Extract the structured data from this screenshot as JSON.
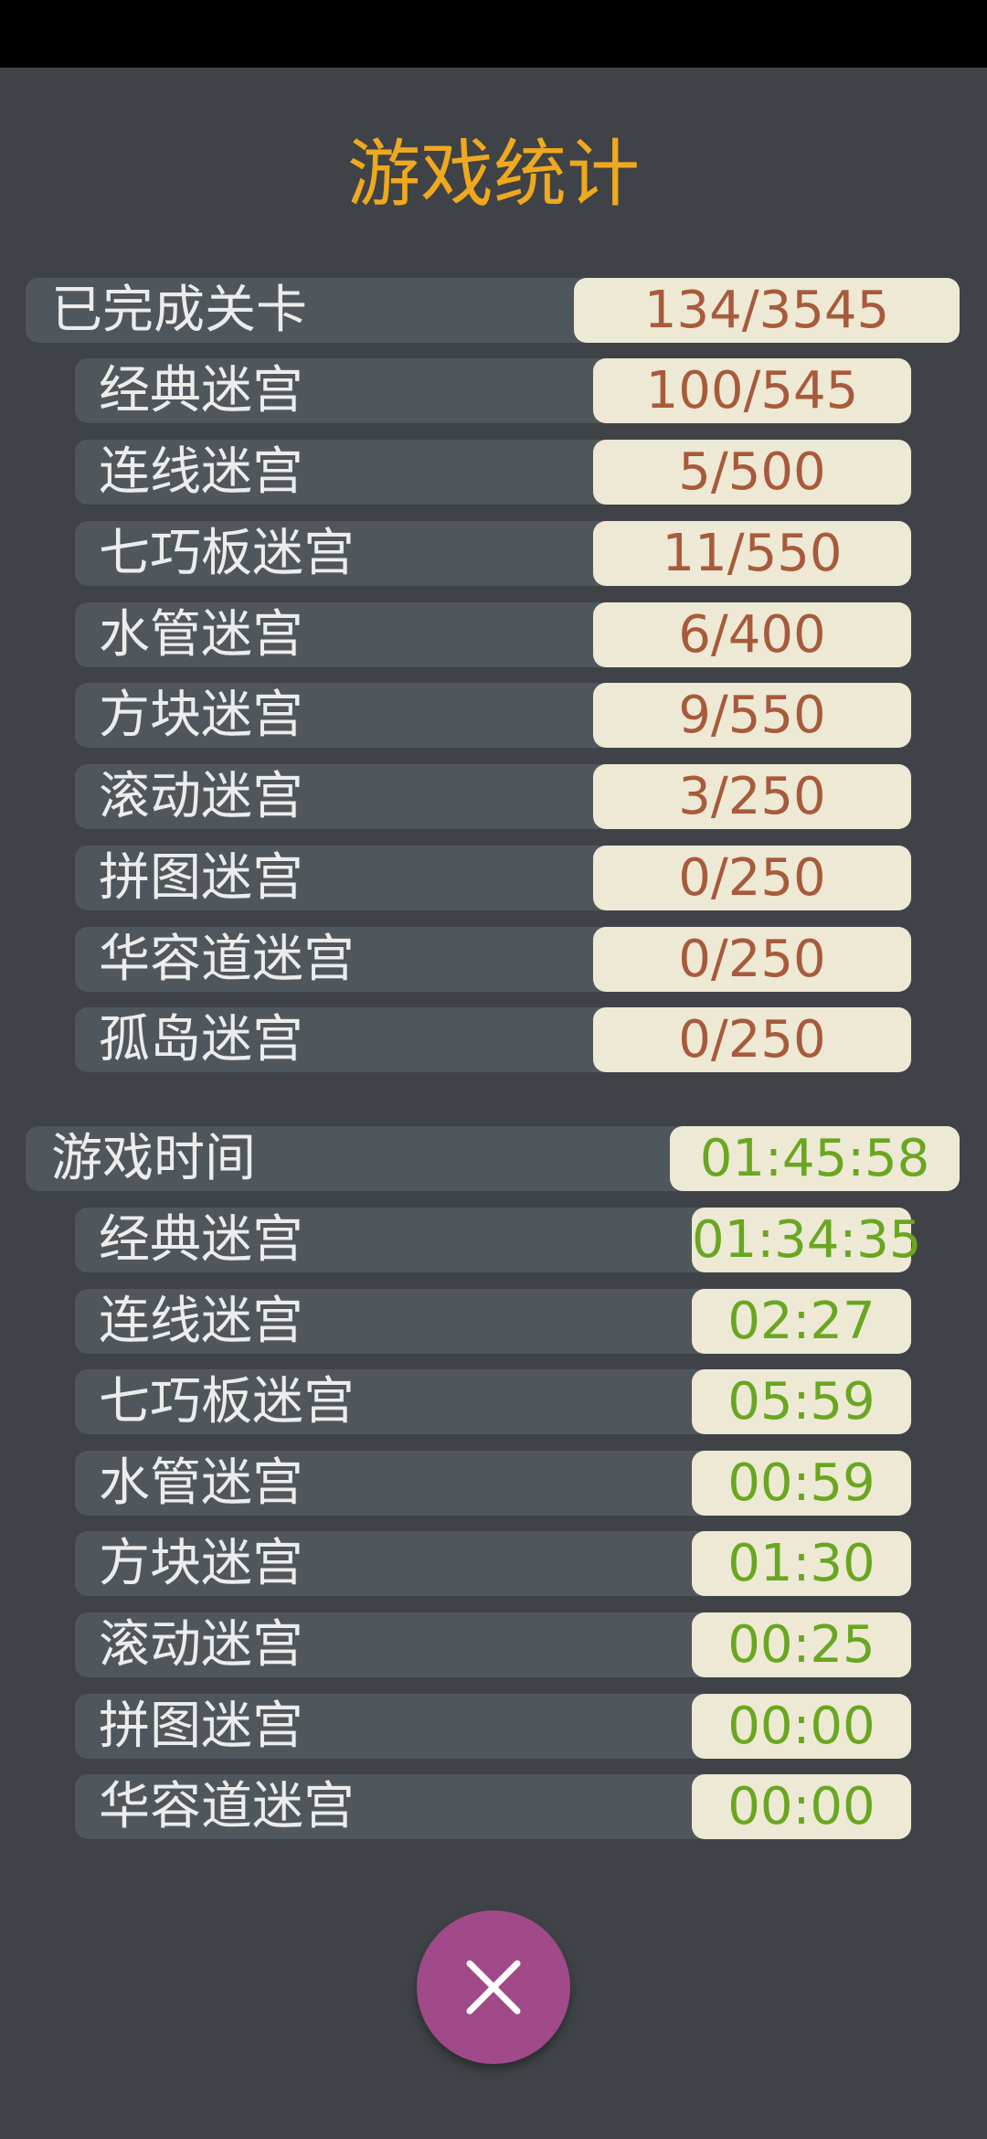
{
  "title": "游戏统计",
  "colors": {
    "background": "#3f4347",
    "row": "#50575c",
    "pill": "#ede9d4",
    "title": "#f0a81e",
    "count_text": "#a85a3c",
    "time_text": "#6aa621",
    "close_button": "#a04a8a"
  },
  "completed": {
    "label": "已完成关卡",
    "value": "134/3545",
    "items": [
      {
        "label": "经典迷宫",
        "value": "100/545"
      },
      {
        "label": "连线迷宫",
        "value": "5/500"
      },
      {
        "label": "七巧板迷宫",
        "value": "11/550"
      },
      {
        "label": "水管迷宫",
        "value": "6/400"
      },
      {
        "label": "方块迷宫",
        "value": "9/550"
      },
      {
        "label": "滚动迷宫",
        "value": "3/250"
      },
      {
        "label": "拼图迷宫",
        "value": "0/250"
      },
      {
        "label": "华容道迷宫",
        "value": "0/250"
      },
      {
        "label": "孤岛迷宫",
        "value": "0/250"
      }
    ]
  },
  "playtime": {
    "label": "游戏时间",
    "value": "01:45:58",
    "items": [
      {
        "label": "经典迷宫",
        "value": "01:34:35"
      },
      {
        "label": "连线迷宫",
        "value": "02:27"
      },
      {
        "label": "七巧板迷宫",
        "value": "05:59"
      },
      {
        "label": "水管迷宫",
        "value": "00:59"
      },
      {
        "label": "方块迷宫",
        "value": "01:30"
      },
      {
        "label": "滚动迷宫",
        "value": "00:25"
      },
      {
        "label": "拼图迷宫",
        "value": "00:00"
      },
      {
        "label": "华容道迷宫",
        "value": "00:00"
      }
    ]
  },
  "close_button": {
    "icon": "close-icon"
  }
}
